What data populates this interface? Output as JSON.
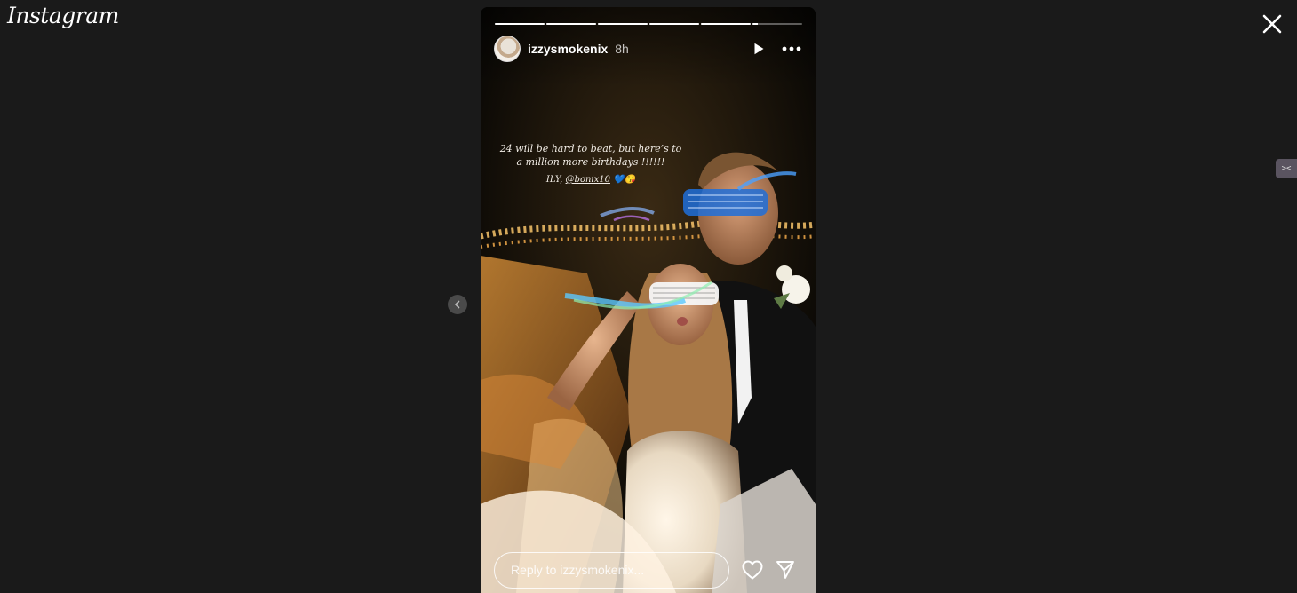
{
  "app": {
    "logo_text": "Instagram"
  },
  "story": {
    "username": "izzysmokenix",
    "time_ago": "8h",
    "progress": {
      "segments": 6,
      "completed": 5,
      "current_fraction": 0.1
    },
    "caption": {
      "line1": "24 will be hard to beat, but here’s to a million more birthdays !!!!!!",
      "line2_prefix": "ILY,",
      "mention": "@bonix10",
      "emoji": "💙😘"
    },
    "reply_placeholder": "Reply to izzysmokenix..."
  },
  "icons": {
    "close": "close-icon",
    "prev": "chevron-left-icon",
    "play": "play-icon",
    "more": "more-horizontal-icon",
    "like": "heart-icon",
    "share": "send-icon",
    "side_widget": "extension-icon"
  },
  "colors": {
    "background": "#1a1a1a",
    "text": "#ffffff",
    "progress_track": "rgba(255,255,255,0.35)",
    "progress_fill": "#ffffff"
  }
}
